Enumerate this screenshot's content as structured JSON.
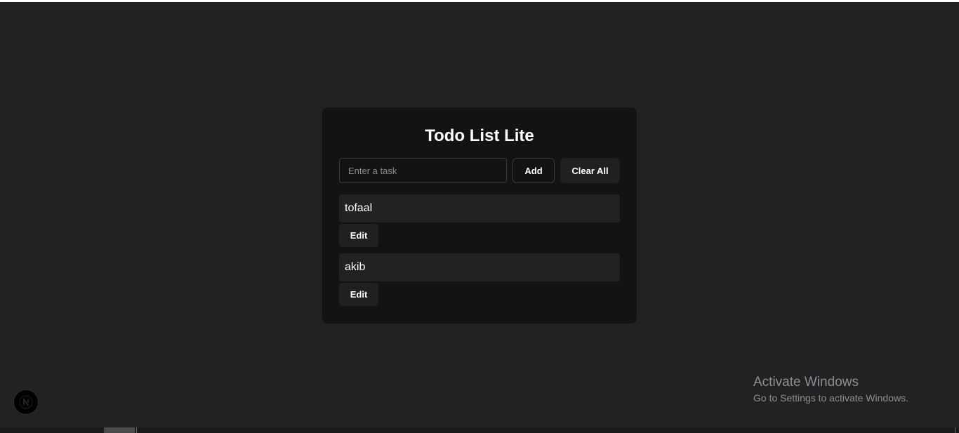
{
  "app": {
    "title": "Todo List Lite"
  },
  "input": {
    "placeholder": "Enter a task",
    "value": ""
  },
  "buttons": {
    "add_label": "Add",
    "clear_all_label": "Clear All",
    "edit_label": "Edit"
  },
  "todos": [
    {
      "text": "tofaal",
      "edit_label": "Edit"
    },
    {
      "text": "akib",
      "edit_label": "Edit"
    }
  ],
  "watermark": {
    "title": "Activate Windows",
    "subtitle": "Go to Settings to activate Windows."
  },
  "badge": {
    "icon": "nextjs-logo-icon"
  },
  "colors": {
    "background": "#222224",
    "card": "#131313",
    "item": "#222224",
    "text": "#ffffff"
  }
}
